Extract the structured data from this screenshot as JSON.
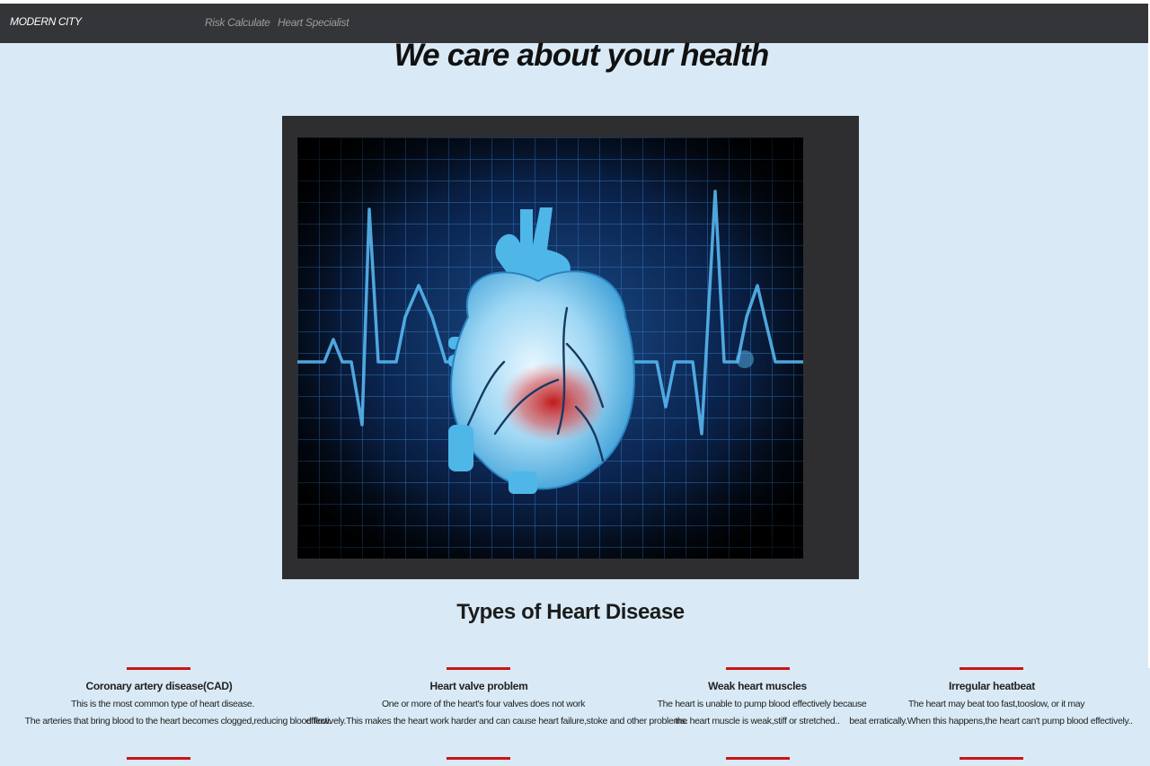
{
  "navbar": {
    "brand": "MODERN CITY",
    "links": [
      "Risk Calculate",
      "Heart Specialist"
    ]
  },
  "hero": {
    "title": "We care about your health"
  },
  "section": {
    "title": "Types of Heart Disease"
  },
  "cards": [
    {
      "title": "Coronary artery disease(CAD)",
      "line1": "This is the most common type of heart disease.",
      "line2": "The arteries that bring blood to the heart becomes clogged,reducing blood flow."
    },
    {
      "title": "Heart valve problem",
      "line1": "One or more of the heart's four valves does not work",
      "line2": "effectively.This makes the heart work harder and can cause heart failure,stoke and other problems."
    },
    {
      "title": "Weak heart muscles",
      "line1": "The heart is unable to pump blood effectively because",
      "line2": "the heart muscle is weak,stiff or stretched.."
    },
    {
      "title": "Irregular heatbeat",
      "line1": "The heart may beat too fast,tooslow, or it may",
      "line2": "beat erratically.When this happens,the heart can't pump blood effectively.."
    }
  ],
  "colors": {
    "page_bg": "#d9eaf6",
    "navbar_bg": "#333538",
    "accent_red": "#cc1414"
  }
}
